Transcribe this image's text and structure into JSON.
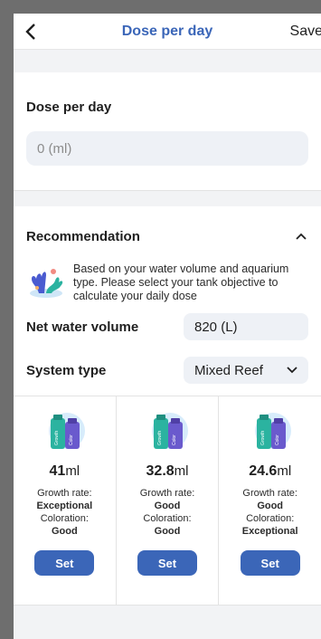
{
  "header": {
    "title": "Dose per day",
    "save_label": "Save",
    "back_icon": "chevron-left-icon"
  },
  "dose": {
    "label": "Dose per day",
    "value": "0 (ml)"
  },
  "recommendation": {
    "title": "Recommendation",
    "note": "Based on your water volume and aquarium type. Please select your tank objective to calculate your daily dose",
    "net_water_label": "Net water volume",
    "net_water_value": "820 (L)",
    "system_type_label": "System type",
    "system_type_value": "Mixed Reef"
  },
  "products": [
    {
      "amount": "41",
      "unit": "ml",
      "growth_label": "Growth rate:",
      "growth": "Exceptional",
      "coloration_label": "Coloration:",
      "coloration": "Good",
      "set_label": "Set"
    },
    {
      "amount": "32.8",
      "unit": "ml",
      "growth_label": "Growth rate:",
      "growth": "Good",
      "coloration_label": "Coloration:",
      "coloration": "Good",
      "set_label": "Set"
    },
    {
      "amount": "24.6",
      "unit": "ml",
      "growth_label": "Growth rate:",
      "growth": "Good",
      "coloration_label": "Coloration:",
      "coloration": "Exceptional",
      "set_label": "Set"
    }
  ],
  "bottle_labels": {
    "left": "Growth",
    "right": "Color"
  },
  "colors": {
    "accent": "#3b66b8",
    "input_bg": "#eef1f6",
    "bottle_green": "#2bb3a0",
    "bottle_purple": "#6a5acd"
  }
}
